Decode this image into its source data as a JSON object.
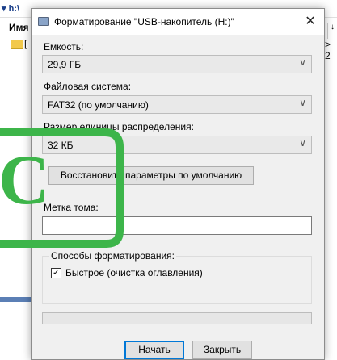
{
  "background": {
    "title_fragment": "▾ h:\\",
    "column_header": "Имя",
    "folder_bracket": "[",
    "right_glyph": "> 2",
    "right_scroll_glyph": "↓"
  },
  "dialog": {
    "title": "Форматирование \"USB-накопитель (H:)\"",
    "close_glyph": "✕",
    "capacity": {
      "label": "Емкость:",
      "value": "29,9 ГБ"
    },
    "filesystem": {
      "label": "Файловая система:",
      "value": "FAT32 (по умолчанию)"
    },
    "cluster": {
      "label": "Размер единицы распределения:",
      "value": "32 КБ"
    },
    "restore_label": "Восстановить параметры по умолчанию",
    "volume_label": {
      "label": "Метка тома:",
      "value": ""
    },
    "format_options": {
      "title": "Способы форматирования:",
      "quick_label": "Быстрое (очистка оглавления)",
      "quick_checked": true,
      "check_glyph": "✓"
    },
    "progress_fraction": 0,
    "start_label": "Начать",
    "close_label": "Закрыть",
    "dropdown_glyph": "∨"
  },
  "overlay": {
    "letter": "C",
    "color": "#3db54a"
  }
}
